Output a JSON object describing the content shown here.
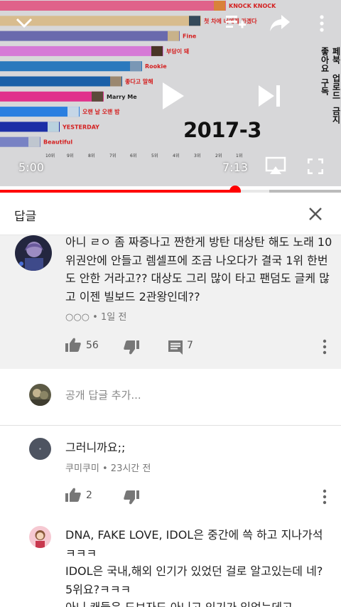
{
  "video": {
    "chart_data": {
      "type": "bar",
      "period": "2017-3",
      "orientation": "horizontal",
      "bars": [
        {
          "label": "KNOCK KNOCK",
          "color": "#e0628a"
        },
        {
          "label": "첫 차에 너에게 가겠다",
          "color": "#d8bc8e"
        },
        {
          "label": "Fine",
          "color": "#6a6aad"
        },
        {
          "label": "부담이 돼",
          "color": "#d679d6"
        },
        {
          "label": "Rookie",
          "color": "#2a79bd"
        },
        {
          "label": "좋다고 말해",
          "color": "#1b60a8"
        },
        {
          "label": "Marry Me",
          "color": "#e0318c"
        },
        {
          "label": "오랜 날 오랜 밤",
          "color": "#2b7fe0"
        },
        {
          "label": "YESTERDAY",
          "color": "#1c2fa6"
        },
        {
          "label": "Beautiful",
          "color": "#7882c4"
        }
      ],
      "ticks": [
        "10위",
        "9위",
        "8위",
        "7위",
        "6위",
        "5위",
        "4위",
        "3위",
        "2위",
        "1위"
      ]
    },
    "side_menu": [
      "좋아요",
      "구독",
      "페북 업로드",
      "금지"
    ],
    "current_time": "5:00",
    "duration": "7:13",
    "progress_fraction": 0.69,
    "accent_color": "#ff0000"
  },
  "replies_header": {
    "title": "답글",
    "close_icon": "close-icon"
  },
  "parent_comment": {
    "text": "아니 ㄹㅇ 좀 짜증나고 짠한게 방탄 대상탄 해도 노래 10위권안에 안들고 렘셀프에 조금 나오다가 결국 1위 한번도 안한 거라고?? 대상도 그리 많이 타고 팬덤도 글케 많고 이젠 빌보드 2관왕인데??",
    "author": "○○○",
    "time": "1일 전",
    "likes": "56",
    "replies": "7"
  },
  "add_reply": {
    "placeholder": "공개 답글 추가..."
  },
  "replies": [
    {
      "text": "그러니까요;;",
      "author": "쿠미쿠미",
      "time": "23시간 전",
      "likes": "2"
    },
    {
      "text": "DNA, FAKE LOVE, IDOL은 중간에 쓱 하고 지나가석ㅋㅋㅋ\nIDOL은 국내,해외 인기가 있었던 걸로 알고있는데 네? 5위요?ㅋㅋㅋ\n아니 캐들은 도보자도 아니고 인기가 있었는데고"
    }
  ]
}
